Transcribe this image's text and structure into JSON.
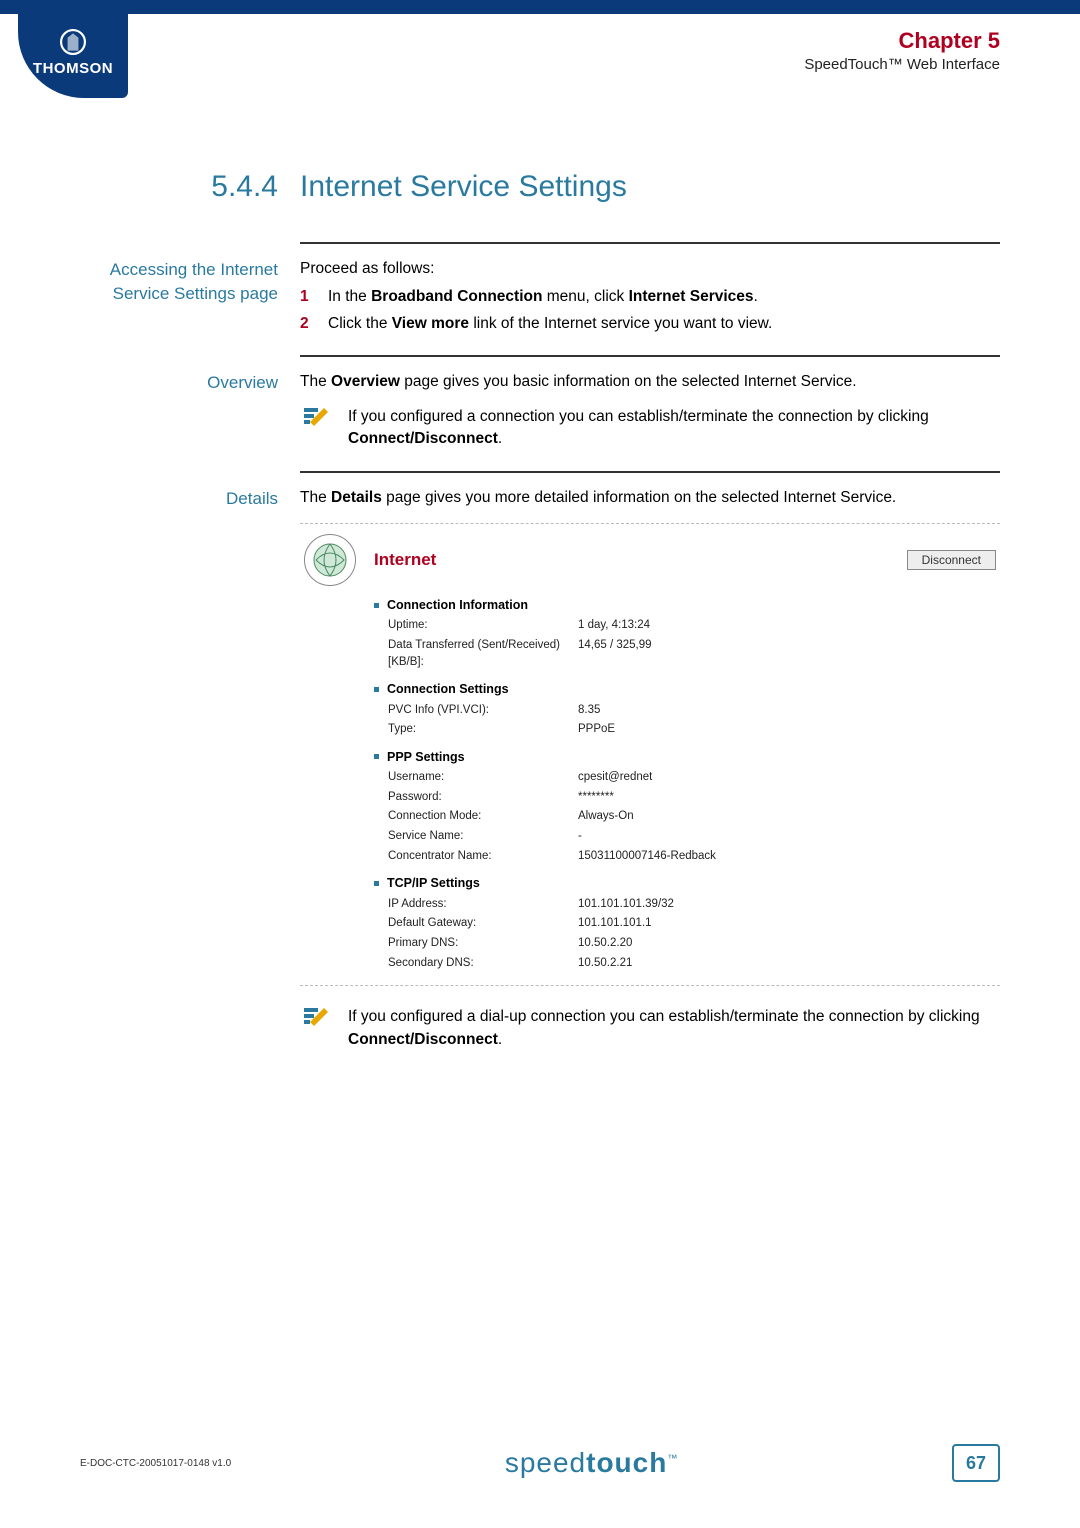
{
  "header": {
    "logo_text": "THOMSON",
    "chapter_label": "Chapter 5",
    "chapter_subtitle": "SpeedTouch™ Web Interface"
  },
  "section": {
    "number": "5.4.4",
    "title": "Internet Service Settings"
  },
  "accessing": {
    "label_line1": "Accessing the Internet",
    "label_line2": "Service Settings page",
    "intro": "Proceed as follows:",
    "steps": [
      {
        "n": "1",
        "prefix": "In the ",
        "bold1": "Broadband Connection",
        "mid": " menu, click ",
        "bold2": "Internet Services",
        "suffix": "."
      },
      {
        "n": "2",
        "prefix": "Click the ",
        "bold1": "View more",
        "mid": " link of the Internet service you want to view.",
        "bold2": "",
        "suffix": ""
      }
    ]
  },
  "overview": {
    "label": "Overview",
    "text_prefix": "The ",
    "text_bold": "Overview",
    "text_suffix": " page gives you basic information on the selected Internet Service.",
    "note_prefix": "If you configured a connection you can establish/terminate the connection by clicking ",
    "note_bold": "Connect/Disconnect",
    "note_suffix": "."
  },
  "details": {
    "label": "Details",
    "text_prefix": "The ",
    "text_bold": "Details",
    "text_suffix": " page gives you more detailed information on the selected Internet Service.",
    "panel_title": "Internet",
    "disconnect_label": "Disconnect",
    "groups": {
      "conn_info": {
        "title": "Connection Information",
        "rows": [
          {
            "label": "Uptime:",
            "value": "1 day, 4:13:24"
          },
          {
            "label": "Data Transferred (Sent/Received) [KB/B]:",
            "value": "14,65 / 325,99"
          }
        ]
      },
      "conn_settings": {
        "title": "Connection Settings",
        "rows": [
          {
            "label": "PVC Info (VPI.VCI):",
            "value": "8.35"
          },
          {
            "label": "Type:",
            "value": "PPPoE"
          }
        ]
      },
      "ppp": {
        "title": "PPP Settings",
        "rows": [
          {
            "label": "Username:",
            "value": "cpesit@rednet"
          },
          {
            "label": "Password:",
            "value": "********"
          },
          {
            "label": "Connection Mode:",
            "value": "Always-On"
          },
          {
            "label": "Service Name:",
            "value": "-"
          },
          {
            "label": "Concentrator Name:",
            "value": "15031100007146-Redback"
          }
        ]
      },
      "tcpip": {
        "title": "TCP/IP Settings",
        "rows": [
          {
            "label": "IP Address:",
            "value": "101.101.101.39/32"
          },
          {
            "label": "Default Gateway:",
            "value": "101.101.101.1"
          },
          {
            "label": "Primary DNS:",
            "value": "10.50.2.20"
          },
          {
            "label": "Secondary DNS:",
            "value": "10.50.2.21"
          }
        ]
      }
    },
    "note_prefix": "If you configured a dial-up connection you can establish/terminate the connection by clicking ",
    "note_bold": "Connect/Disconnect",
    "note_suffix": "."
  },
  "footer": {
    "doc_id": "E-DOC-CTC-20051017-0148 v1.0",
    "brand_light": "speed",
    "brand_bold": "touch",
    "page_number": "67"
  }
}
